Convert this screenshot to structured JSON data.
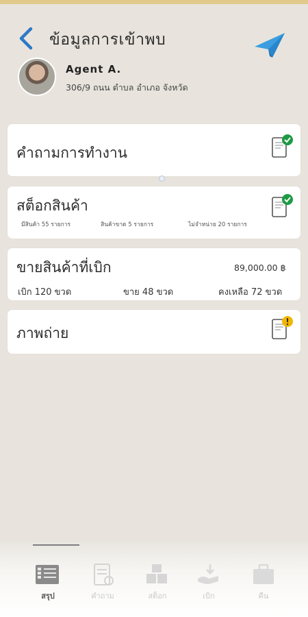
{
  "header": {
    "title": "ข้อมูลการเข้าพบ"
  },
  "agent": {
    "name": "Agent A.",
    "address": "306/9 ถนน ตำบล อำเภอ จังหวัด"
  },
  "cards": {
    "questions": {
      "title": "คำถามการทำงาน",
      "status": "complete"
    },
    "stock": {
      "title": "สต็อกสินค้า",
      "status": "complete",
      "stats": [
        "มีสินค้า 55 รายการ",
        "สินค้าขาด 5 รายการ",
        "ไม่จำหน่าย 20 รายการ"
      ]
    },
    "sales": {
      "title": "ขายสินค้าที่เบิก",
      "amount": "89,000.00 ฿",
      "stats": [
        "เบิก 120 ขวด",
        "ขาย 48 ขวด",
        "คงเหลือ 72 ขวด"
      ]
    },
    "photos": {
      "title": "ภาพถ่าย",
      "status": "warning"
    }
  },
  "tabs": [
    {
      "label": "สรุป",
      "icon": "summary-icon",
      "active": true
    },
    {
      "label": "คำถาม",
      "icon": "questionnaire-icon",
      "active": false
    },
    {
      "label": "สต็อก",
      "icon": "stock-boxes-icon",
      "active": false
    },
    {
      "label": "เบิก",
      "icon": "withdraw-icon",
      "active": false
    },
    {
      "label": "คืน",
      "icon": "return-briefcase-icon",
      "active": false
    }
  ],
  "colors": {
    "accent": "#2e78c8",
    "check": "#1f9a45",
    "warning": "#f2b600",
    "topbar": "#e1c98c"
  }
}
